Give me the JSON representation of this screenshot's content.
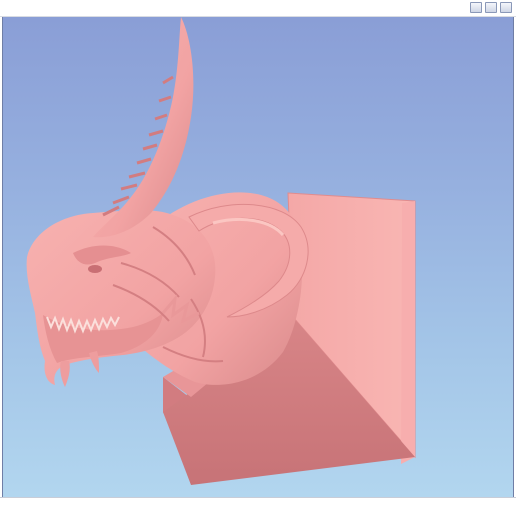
{
  "window": {
    "title": "",
    "buttons": [
      "minimize",
      "maximize",
      "close"
    ]
  },
  "viewport": {
    "background_top": "#8a9ed6",
    "background_bottom": "#b2d6ef",
    "model_color": "#f2a3a3",
    "model_shadow_color": "#cf7e80"
  },
  "status": {
    "text": ""
  }
}
